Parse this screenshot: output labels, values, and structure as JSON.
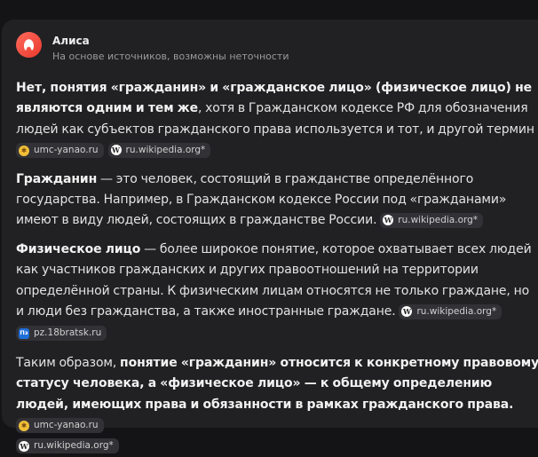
{
  "assistant": {
    "name": "Алиса",
    "subtitle": "На основе источников, возможны неточности"
  },
  "answer": {
    "p1": {
      "bold": "Нет, понятия «гражданин» и «гражданское лицо» (физическое лицо) не являются одним и тем же",
      "text": ", хотя в Гражданском кодексе РФ для обозначения людей как субъектов гражданского права используется и тот, и другой термин"
    },
    "p2": {
      "bold": "Гражданин",
      "text": " — это человек, состоящий в гражданстве определённого государства. Например, в Гражданском кодексе России под «гражданами» имеют в виду людей, состоящих в гражданстве России."
    },
    "p3": {
      "bold": "Физическое лицо",
      "text": " — более широкое понятие, которое охватывает всех людей как участников гражданских и других правоотношений на территории определённой страны. К физическим лицам относятся не только граждане, но и люди без гражданства, а также иностранные граждане."
    },
    "p4": {
      "text_start": "Таким образом, ",
      "bold": "понятие «гражданин» относится к конкретному правовому статусу человека, а «физическое лицо» — к общему определению людей, имеющих права и обязанности в рамках гражданского права."
    }
  },
  "sources": {
    "umc": "umc-yanao.ru",
    "wiki": "ru.wikipedia.org*",
    "pz": "pz.18bratsk.ru"
  },
  "colors": {
    "background": "#141416",
    "card": "#212123",
    "chip": "#323236",
    "avatar": "#ff5a4a"
  },
  "icons": {
    "avatar": "alice-logo-icon",
    "umc": "umc-favicon-icon",
    "wiki": "wikipedia-favicon-icon",
    "pz": "pz-favicon-icon"
  }
}
